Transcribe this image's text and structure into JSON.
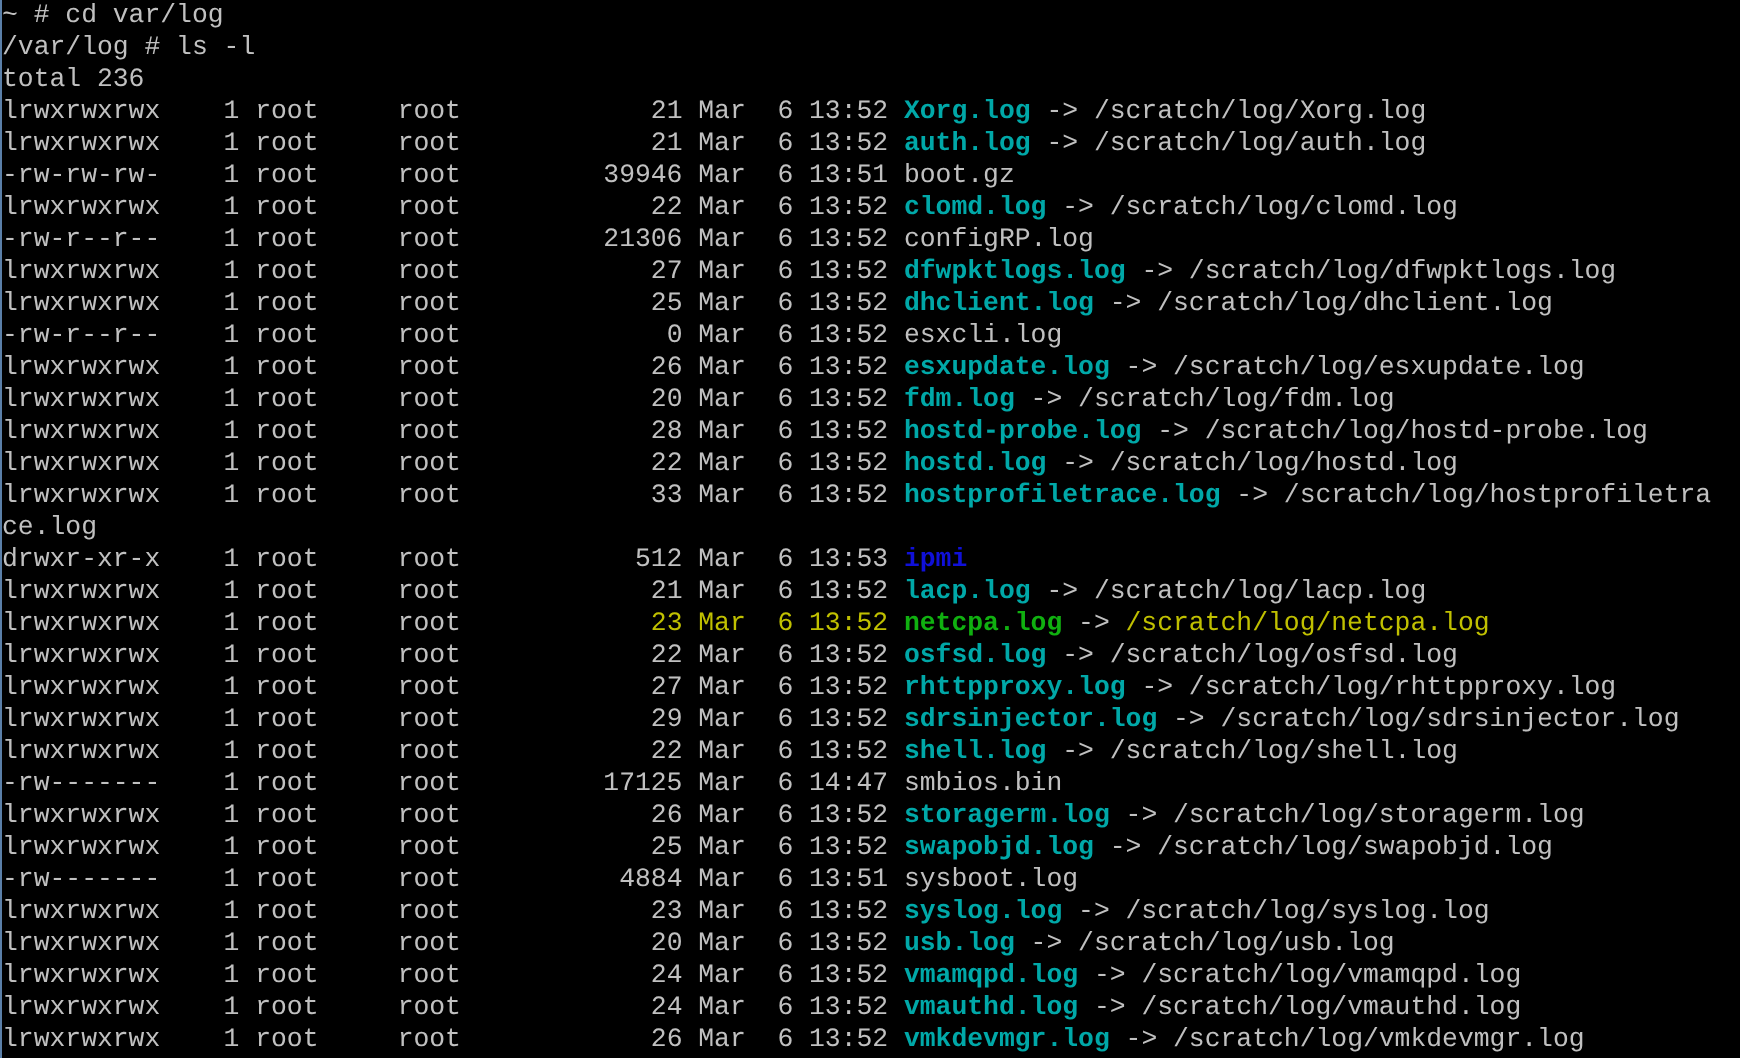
{
  "terminal": {
    "lines": [
      {
        "kind": "command",
        "prompt": "~ #",
        "command": "cd var/log"
      },
      {
        "kind": "command",
        "prompt": "/var/log #",
        "command": "ls -l"
      },
      {
        "kind": "text",
        "text": "total 236"
      },
      {
        "kind": "link",
        "perms": "lrwxrwxrwx",
        "links": "1",
        "owner": "root",
        "group": "root",
        "bytes": "21",
        "month": "Mar",
        "day": "6",
        "time": "13:52",
        "name": "Xorg.log",
        "separator": "->",
        "target": "/scratch/log/Xorg.log"
      },
      {
        "kind": "link",
        "perms": "lrwxrwxrwx",
        "links": "1",
        "owner": "root",
        "group": "root",
        "bytes": "21",
        "month": "Mar",
        "day": "6",
        "time": "13:52",
        "name": "auth.log",
        "separator": "->",
        "target": "/scratch/log/auth.log"
      },
      {
        "kind": "file",
        "perms": "-rw-rw-rw-",
        "links": "1",
        "owner": "root",
        "group": "root",
        "bytes": "39946",
        "month": "Mar",
        "day": "6",
        "time": "13:51",
        "name": "boot.gz"
      },
      {
        "kind": "link",
        "perms": "lrwxrwxrwx",
        "links": "1",
        "owner": "root",
        "group": "root",
        "bytes": "22",
        "month": "Mar",
        "day": "6",
        "time": "13:52",
        "name": "clomd.log",
        "separator": "->",
        "target": "/scratch/log/clomd.log"
      },
      {
        "kind": "file",
        "perms": "-rw-r--r--",
        "links": "1",
        "owner": "root",
        "group": "root",
        "bytes": "21306",
        "month": "Mar",
        "day": "6",
        "time": "13:52",
        "name": "configRP.log"
      },
      {
        "kind": "link",
        "perms": "lrwxrwxrwx",
        "links": "1",
        "owner": "root",
        "group": "root",
        "bytes": "27",
        "month": "Mar",
        "day": "6",
        "time": "13:52",
        "name": "dfwpktlogs.log",
        "separator": "->",
        "target": "/scratch/log/dfwpktlogs.log"
      },
      {
        "kind": "link",
        "perms": "lrwxrwxrwx",
        "links": "1",
        "owner": "root",
        "group": "root",
        "bytes": "25",
        "month": "Mar",
        "day": "6",
        "time": "13:52",
        "name": "dhclient.log",
        "separator": "->",
        "target": "/scratch/log/dhclient.log"
      },
      {
        "kind": "file",
        "perms": "-rw-r--r--",
        "links": "1",
        "owner": "root",
        "group": "root",
        "bytes": "0",
        "month": "Mar",
        "day": "6",
        "time": "13:52",
        "name": "esxcli.log"
      },
      {
        "kind": "link",
        "perms": "lrwxrwxrwx",
        "links": "1",
        "owner": "root",
        "group": "root",
        "bytes": "26",
        "month": "Mar",
        "day": "6",
        "time": "13:52",
        "name": "esxupdate.log",
        "separator": "->",
        "target": "/scratch/log/esxupdate.log"
      },
      {
        "kind": "link",
        "perms": "lrwxrwxrwx",
        "links": "1",
        "owner": "root",
        "group": "root",
        "bytes": "20",
        "month": "Mar",
        "day": "6",
        "time": "13:52",
        "name": "fdm.log",
        "separator": "->",
        "target": "/scratch/log/fdm.log"
      },
      {
        "kind": "link",
        "perms": "lrwxrwxrwx",
        "links": "1",
        "owner": "root",
        "group": "root",
        "bytes": "28",
        "month": "Mar",
        "day": "6",
        "time": "13:52",
        "name": "hostd-probe.log",
        "separator": "->",
        "target": "/scratch/log/hostd-probe.log"
      },
      {
        "kind": "link",
        "perms": "lrwxrwxrwx",
        "links": "1",
        "owner": "root",
        "group": "root",
        "bytes": "22",
        "month": "Mar",
        "day": "6",
        "time": "13:52",
        "name": "hostd.log",
        "separator": "->",
        "target": "/scratch/log/hostd.log"
      },
      {
        "kind": "link",
        "perms": "lrwxrwxrwx",
        "links": "1",
        "owner": "root",
        "group": "root",
        "bytes": "33",
        "month": "Mar",
        "day": "6",
        "time": "13:52",
        "name": "hostprofiletrace.log",
        "separator": "->",
        "target": "/scratch/log/hostprofiletra"
      },
      {
        "kind": "text",
        "text": "ce.log"
      },
      {
        "kind": "dir",
        "perms": "drwxr-xr-x",
        "links": "1",
        "owner": "root",
        "group": "root",
        "bytes": "512",
        "month": "Mar",
        "day": "6",
        "time": "13:53",
        "name": "ipmi"
      },
      {
        "kind": "link",
        "perms": "lrwxrwxrwx",
        "links": "1",
        "owner": "root",
        "group": "root",
        "bytes": "21",
        "month": "Mar",
        "day": "6",
        "time": "13:52",
        "name": "lacp.log",
        "separator": "->",
        "target": "/scratch/log/lacp.log"
      },
      {
        "kind": "highlight",
        "perms": "lrwxrwxrwx",
        "links": "1",
        "owner": "root",
        "group": "root",
        "bytes": "23",
        "month": "Mar",
        "day": "6",
        "time": "13:52",
        "name": "netcpa.log",
        "separator": "->",
        "target": "/scratch/log/netcpa.log"
      },
      {
        "kind": "link",
        "perms": "lrwxrwxrwx",
        "links": "1",
        "owner": "root",
        "group": "root",
        "bytes": "22",
        "month": "Mar",
        "day": "6",
        "time": "13:52",
        "name": "osfsd.log",
        "separator": "->",
        "target": "/scratch/log/osfsd.log"
      },
      {
        "kind": "link",
        "perms": "lrwxrwxrwx",
        "links": "1",
        "owner": "root",
        "group": "root",
        "bytes": "27",
        "month": "Mar",
        "day": "6",
        "time": "13:52",
        "name": "rhttpproxy.log",
        "separator": "->",
        "target": "/scratch/log/rhttpproxy.log"
      },
      {
        "kind": "link",
        "perms": "lrwxrwxrwx",
        "links": "1",
        "owner": "root",
        "group": "root",
        "bytes": "29",
        "month": "Mar",
        "day": "6",
        "time": "13:52",
        "name": "sdrsinjector.log",
        "separator": "->",
        "target": "/scratch/log/sdrsinjector.log"
      },
      {
        "kind": "link",
        "perms": "lrwxrwxrwx",
        "links": "1",
        "owner": "root",
        "group": "root",
        "bytes": "22",
        "month": "Mar",
        "day": "6",
        "time": "13:52",
        "name": "shell.log",
        "separator": "->",
        "target": "/scratch/log/shell.log"
      },
      {
        "kind": "file",
        "perms": "-rw-------",
        "links": "1",
        "owner": "root",
        "group": "root",
        "bytes": "17125",
        "month": "Mar",
        "day": "6",
        "time": "14:47",
        "name": "smbios.bin"
      },
      {
        "kind": "link",
        "perms": "lrwxrwxrwx",
        "links": "1",
        "owner": "root",
        "group": "root",
        "bytes": "26",
        "month": "Mar",
        "day": "6",
        "time": "13:52",
        "name": "storagerm.log",
        "separator": "->",
        "target": "/scratch/log/storagerm.log"
      },
      {
        "kind": "link",
        "perms": "lrwxrwxrwx",
        "links": "1",
        "owner": "root",
        "group": "root",
        "bytes": "25",
        "month": "Mar",
        "day": "6",
        "time": "13:52",
        "name": "swapobjd.log",
        "separator": "->",
        "target": "/scratch/log/swapobjd.log"
      },
      {
        "kind": "file",
        "perms": "-rw-------",
        "links": "1",
        "owner": "root",
        "group": "root",
        "bytes": "4884",
        "month": "Mar",
        "day": "6",
        "time": "13:51",
        "name": "sysboot.log"
      },
      {
        "kind": "link",
        "perms": "lrwxrwxrwx",
        "links": "1",
        "owner": "root",
        "group": "root",
        "bytes": "23",
        "month": "Mar",
        "day": "6",
        "time": "13:52",
        "name": "syslog.log",
        "separator": "->",
        "target": "/scratch/log/syslog.log"
      },
      {
        "kind": "link",
        "perms": "lrwxrwxrwx",
        "links": "1",
        "owner": "root",
        "group": "root",
        "bytes": "20",
        "month": "Mar",
        "day": "6",
        "time": "13:52",
        "name": "usb.log",
        "separator": "->",
        "target": "/scratch/log/usb.log"
      },
      {
        "kind": "link",
        "perms": "lrwxrwxrwx",
        "links": "1",
        "owner": "root",
        "group": "root",
        "bytes": "24",
        "month": "Mar",
        "day": "6",
        "time": "13:52",
        "name": "vmamqpd.log",
        "separator": "->",
        "target": "/scratch/log/vmamqpd.log"
      },
      {
        "kind": "link",
        "perms": "lrwxrwxrwx",
        "links": "1",
        "owner": "root",
        "group": "root",
        "bytes": "24",
        "month": "Mar",
        "day": "6",
        "time": "13:52",
        "name": "vmauthd.log",
        "separator": "->",
        "target": "/scratch/log/vmauthd.log"
      },
      {
        "kind": "link",
        "perms": "lrwxrwxrwx",
        "links": "1",
        "owner": "root",
        "group": "root",
        "bytes": "26",
        "month": "Mar",
        "day": "6",
        "time": "13:52",
        "name": "vmkdevmgr.log",
        "separator": "->",
        "target": "/scratch/log/vmkdevmgr.log"
      }
    ]
  }
}
